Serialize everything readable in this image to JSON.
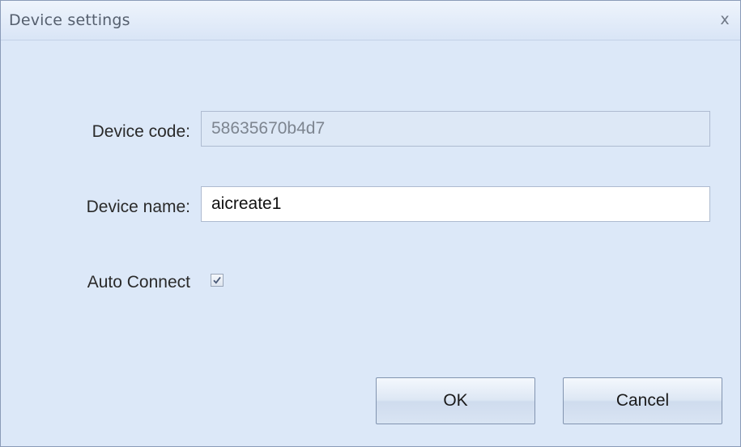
{
  "window": {
    "title": "Device settings",
    "close_symbol": "x"
  },
  "form": {
    "device_code_label": "Device code:",
    "device_code_value": "58635670b4d7",
    "device_name_label": "Device name:",
    "device_name_value": "aicreate1",
    "auto_connect_label": "Auto Connect",
    "auto_connect_checked": true
  },
  "buttons": {
    "ok_label": "OK",
    "cancel_label": "Cancel"
  },
  "icons": {
    "close": "close-icon",
    "check": "checkmark-icon"
  },
  "colors": {
    "dialog_background": "#dce8f8",
    "title_text": "#555f6e",
    "readonly_field_background": "#dde8f6"
  }
}
